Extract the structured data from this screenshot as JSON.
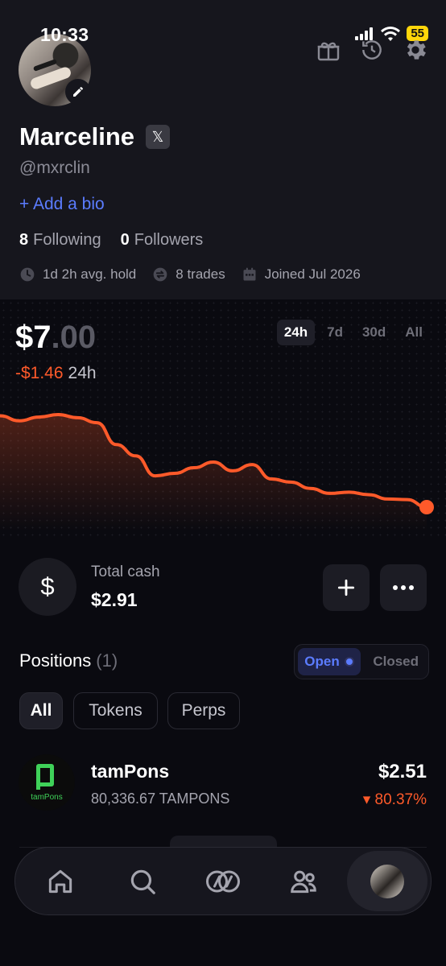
{
  "status_bar": {
    "time": "10:33",
    "battery": "55"
  },
  "profile": {
    "name": "Marceline",
    "x_badge": "𝕏",
    "handle": "@mxrclin",
    "add_bio": "+ Add a bio",
    "following_count": "8",
    "following_label": "Following",
    "followers_count": "0",
    "followers_label": "Followers",
    "avg_hold": "1d 2h avg. hold",
    "trades": "8 trades",
    "joined": "Joined Jul 2026"
  },
  "portfolio": {
    "balance_dollars": "$7",
    "balance_cents": ".00",
    "change_amount": "-$1.46",
    "change_period": "24h",
    "ranges": [
      "24h",
      "7d",
      "30d",
      "All"
    ],
    "active_range": "24h",
    "line_color": "#ff5a2a"
  },
  "chart_data": {
    "type": "line",
    "title": "",
    "series": [
      {
        "values": [
          8.46,
          8.38,
          8.44,
          8.48,
          8.43,
          8.35,
          8.0,
          7.82,
          7.5,
          7.54,
          7.63,
          7.72,
          7.58,
          7.68,
          7.45,
          7.4,
          7.3,
          7.22,
          7.24,
          7.2,
          7.13,
          7.12,
          7.0
        ]
      }
    ]
  },
  "cash": {
    "label": "Total cash",
    "value": "$2.91",
    "icon": "dollar-icon"
  },
  "positions": {
    "title": "Positions",
    "count": "(1)",
    "toggle_open": "Open",
    "toggle_closed": "Closed",
    "filters": [
      "All",
      "Tokens",
      "Perps"
    ],
    "items": [
      {
        "name": "tamPons",
        "logo_text": "tamPons",
        "amount": "80,336.67 TAMPONS",
        "value": "$2.51",
        "change": "▾ 80.37%"
      }
    ]
  },
  "nav": {
    "icons": [
      "home-icon",
      "search-icon",
      "trade-icon",
      "people-icon",
      "profile-avatar"
    ]
  },
  "colors": {
    "accent": "#5b7cff",
    "negative": "#ff5a2a",
    "background": "#0a0a10"
  }
}
